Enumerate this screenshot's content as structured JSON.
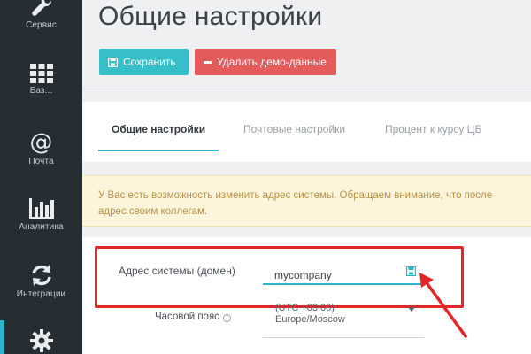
{
  "sidebar": {
    "items": [
      {
        "label": "Сервис",
        "icon": "wrench-icon"
      },
      {
        "label": "Баз...",
        "icon": "grid-icon"
      },
      {
        "label": "Почта",
        "icon": "at-icon"
      },
      {
        "label": "Аналитика",
        "icon": "bar-chart-icon"
      },
      {
        "label": "Интеграции",
        "icon": "sync-icon"
      },
      {
        "label": "",
        "icon": "gear-icon"
      }
    ]
  },
  "page": {
    "title": "Общие настройки"
  },
  "toolbar": {
    "save_label": "Сохранить",
    "delete_demo_label": "Удалить демо-данные"
  },
  "tabs": [
    {
      "label": "Общие настройки",
      "active": true
    },
    {
      "label": "Почтовые настройки",
      "active": false
    },
    {
      "label": "Процент к курсу ЦБ",
      "active": false
    }
  ],
  "alert": {
    "line1": "У Вас есть возможность изменить адрес системы. Обращаем внимание, что после",
    "line2": "адрес своим коллегам."
  },
  "form": {
    "domain_label": "Адрес системы (домен)",
    "domain_value": "mycompany",
    "timezone_label": "Часовой пояс",
    "timezone_line1": "(UTC +03:00)",
    "timezone_line2": "Europe/Moscow"
  },
  "colors": {
    "accent": "#2db6c6",
    "danger": "#e35b5b",
    "highlight": "#e02828",
    "sidebar": "#262d33"
  }
}
